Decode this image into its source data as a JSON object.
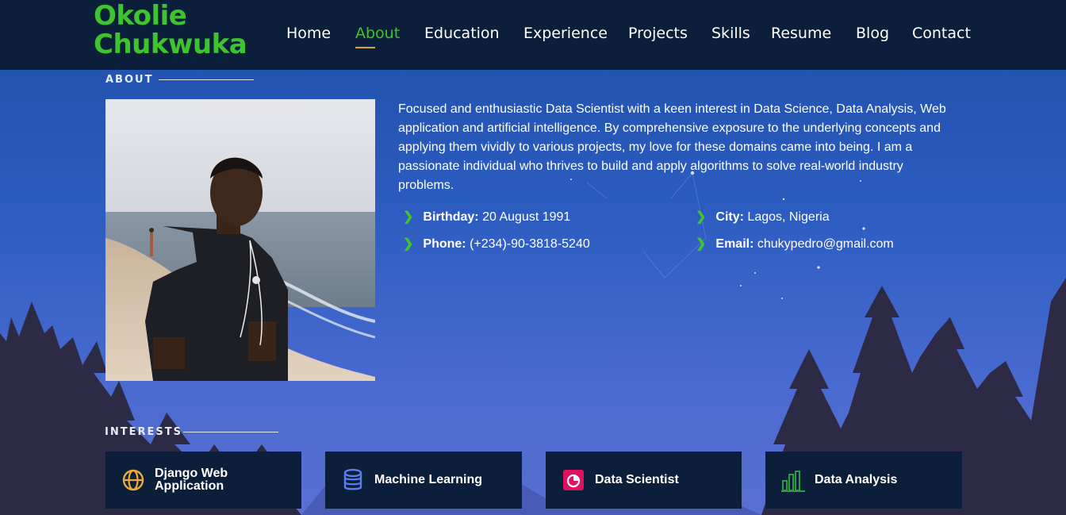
{
  "brand": {
    "line1": "Okolie",
    "line2": "Chukwuka"
  },
  "nav": {
    "items": [
      "Home",
      "About",
      "Education",
      "Experience",
      "Projects",
      "Skills",
      "Resume",
      "Blog",
      "Contact"
    ],
    "active": "About"
  },
  "about": {
    "title": "ABOUT",
    "bio": "Focused and enthusiastic Data Scientist with a keen interest in Data Science, Data Analysis, Web application and artificial intelligence. By comprehensive exposure to the underlying concepts and applying them vividly to various projects, my love for these domains came into being. I am a passionate individual who thrives to build and apply algorithms to solve real-world industry problems.",
    "details": {
      "birthday_label": "Birthday:",
      "birthday": "20 August 1991",
      "city_label": "City:",
      "city": "Lagos, Nigeria",
      "phone_label": "Phone:",
      "phone": "(+234)-90-3818-5240",
      "email_label": "Email:",
      "email": "chukypedro@gmail.com"
    }
  },
  "interests": {
    "title": "INTERESTS",
    "items": [
      {
        "label": "Django Web Application",
        "icon": "globe-icon",
        "color": "#f0a93a"
      },
      {
        "label": "Machine Learning",
        "icon": "database-icon",
        "color": "#5b7df0"
      },
      {
        "label": "Data Scientist",
        "icon": "pie-chart-icon",
        "color": "#e0115f"
      },
      {
        "label": "Data Analysis",
        "icon": "bar-chart-icon",
        "color": "#2e9b3d"
      }
    ]
  },
  "colors": {
    "accent": "#3ec42f",
    "topbar": "#0c1f3a",
    "nav_underline": "#d8a23a",
    "background": "#2b5cc0",
    "trees": "#2c2a45"
  }
}
